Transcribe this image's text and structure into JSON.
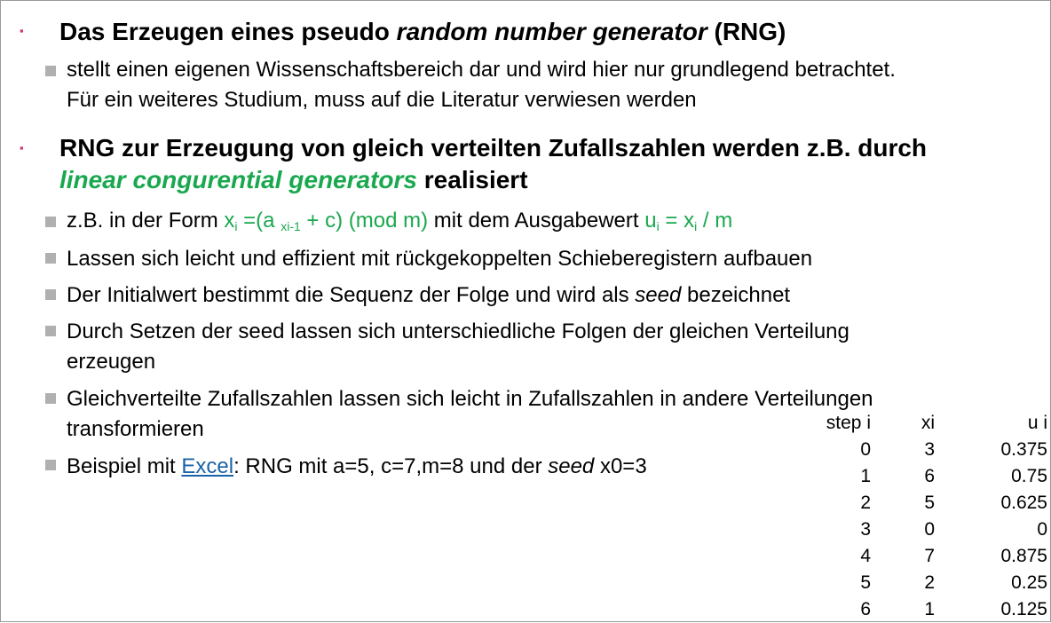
{
  "heading1": {
    "before": "Das Erzeugen eines pseudo ",
    "italic": "random number generator",
    "after": " (RNG)"
  },
  "sub1": {
    "line1": "stellt einen eigenen Wissenschaftsbereich dar und wird hier nur grundlegend betrachtet.",
    "line2": "Für ein weiteres Studium, muss auf die Literatur verwiesen werden"
  },
  "heading2": {
    "line1": "RNG zur Erzeugung von gleich verteilten Zufallszahlen werden z.B. durch",
    "green_italic": "linear congurential generators",
    "after": " realisiert"
  },
  "bullets": {
    "form": {
      "prefix": "z.B. in der Form ",
      "x": "x",
      "i": "i",
      "eq_a": " =(a ",
      "xi1": "xi-1",
      "tail": " + c) (mod m)",
      "mid": " mit dem Ausgabewert ",
      "u": "u",
      "u_i": "i",
      "eq_x": " = x",
      "x_i": "i",
      "div": " / m"
    },
    "shift": "Lassen sich leicht und effizient mit rückgekoppelten Schieberegistern aufbauen",
    "seed": {
      "before": "Der Initialwert bestimmt die Sequenz der Folge und wird als ",
      "italic": "seed",
      "after": " bezeichnet"
    },
    "setzen": {
      "line1": "Durch Setzen der seed lassen sich unterschiedliche Folgen der gleichen Verteilung",
      "line2": "erzeugen"
    },
    "gleich": {
      "line1": "Gleichverteilte Zufallszahlen lassen sich leicht in Zufallszahlen in andere Verteilungen",
      "line2": "transformieren"
    },
    "beispiel": {
      "before": "Beispiel mit ",
      "link": "Excel",
      "middle": ": RNG mit a=5, c=7,m=8 und der ",
      "italic": "seed",
      "after": " x0=3"
    }
  },
  "table": {
    "headers": [
      "step i",
      "xi",
      "u i"
    ],
    "rows": [
      [
        "0",
        "3",
        "0.375"
      ],
      [
        "1",
        "6",
        "0.75"
      ],
      [
        "2",
        "5",
        "0.625"
      ],
      [
        "3",
        "0",
        "0"
      ],
      [
        "4",
        "7",
        "0.875"
      ],
      [
        "5",
        "2",
        "0.25"
      ],
      [
        "6",
        "1",
        "0.125"
      ]
    ]
  },
  "colors": {
    "accent_green": "#1aa84f",
    "bullet_pink": "#d6336c",
    "link_blue": "#1b62a8"
  }
}
